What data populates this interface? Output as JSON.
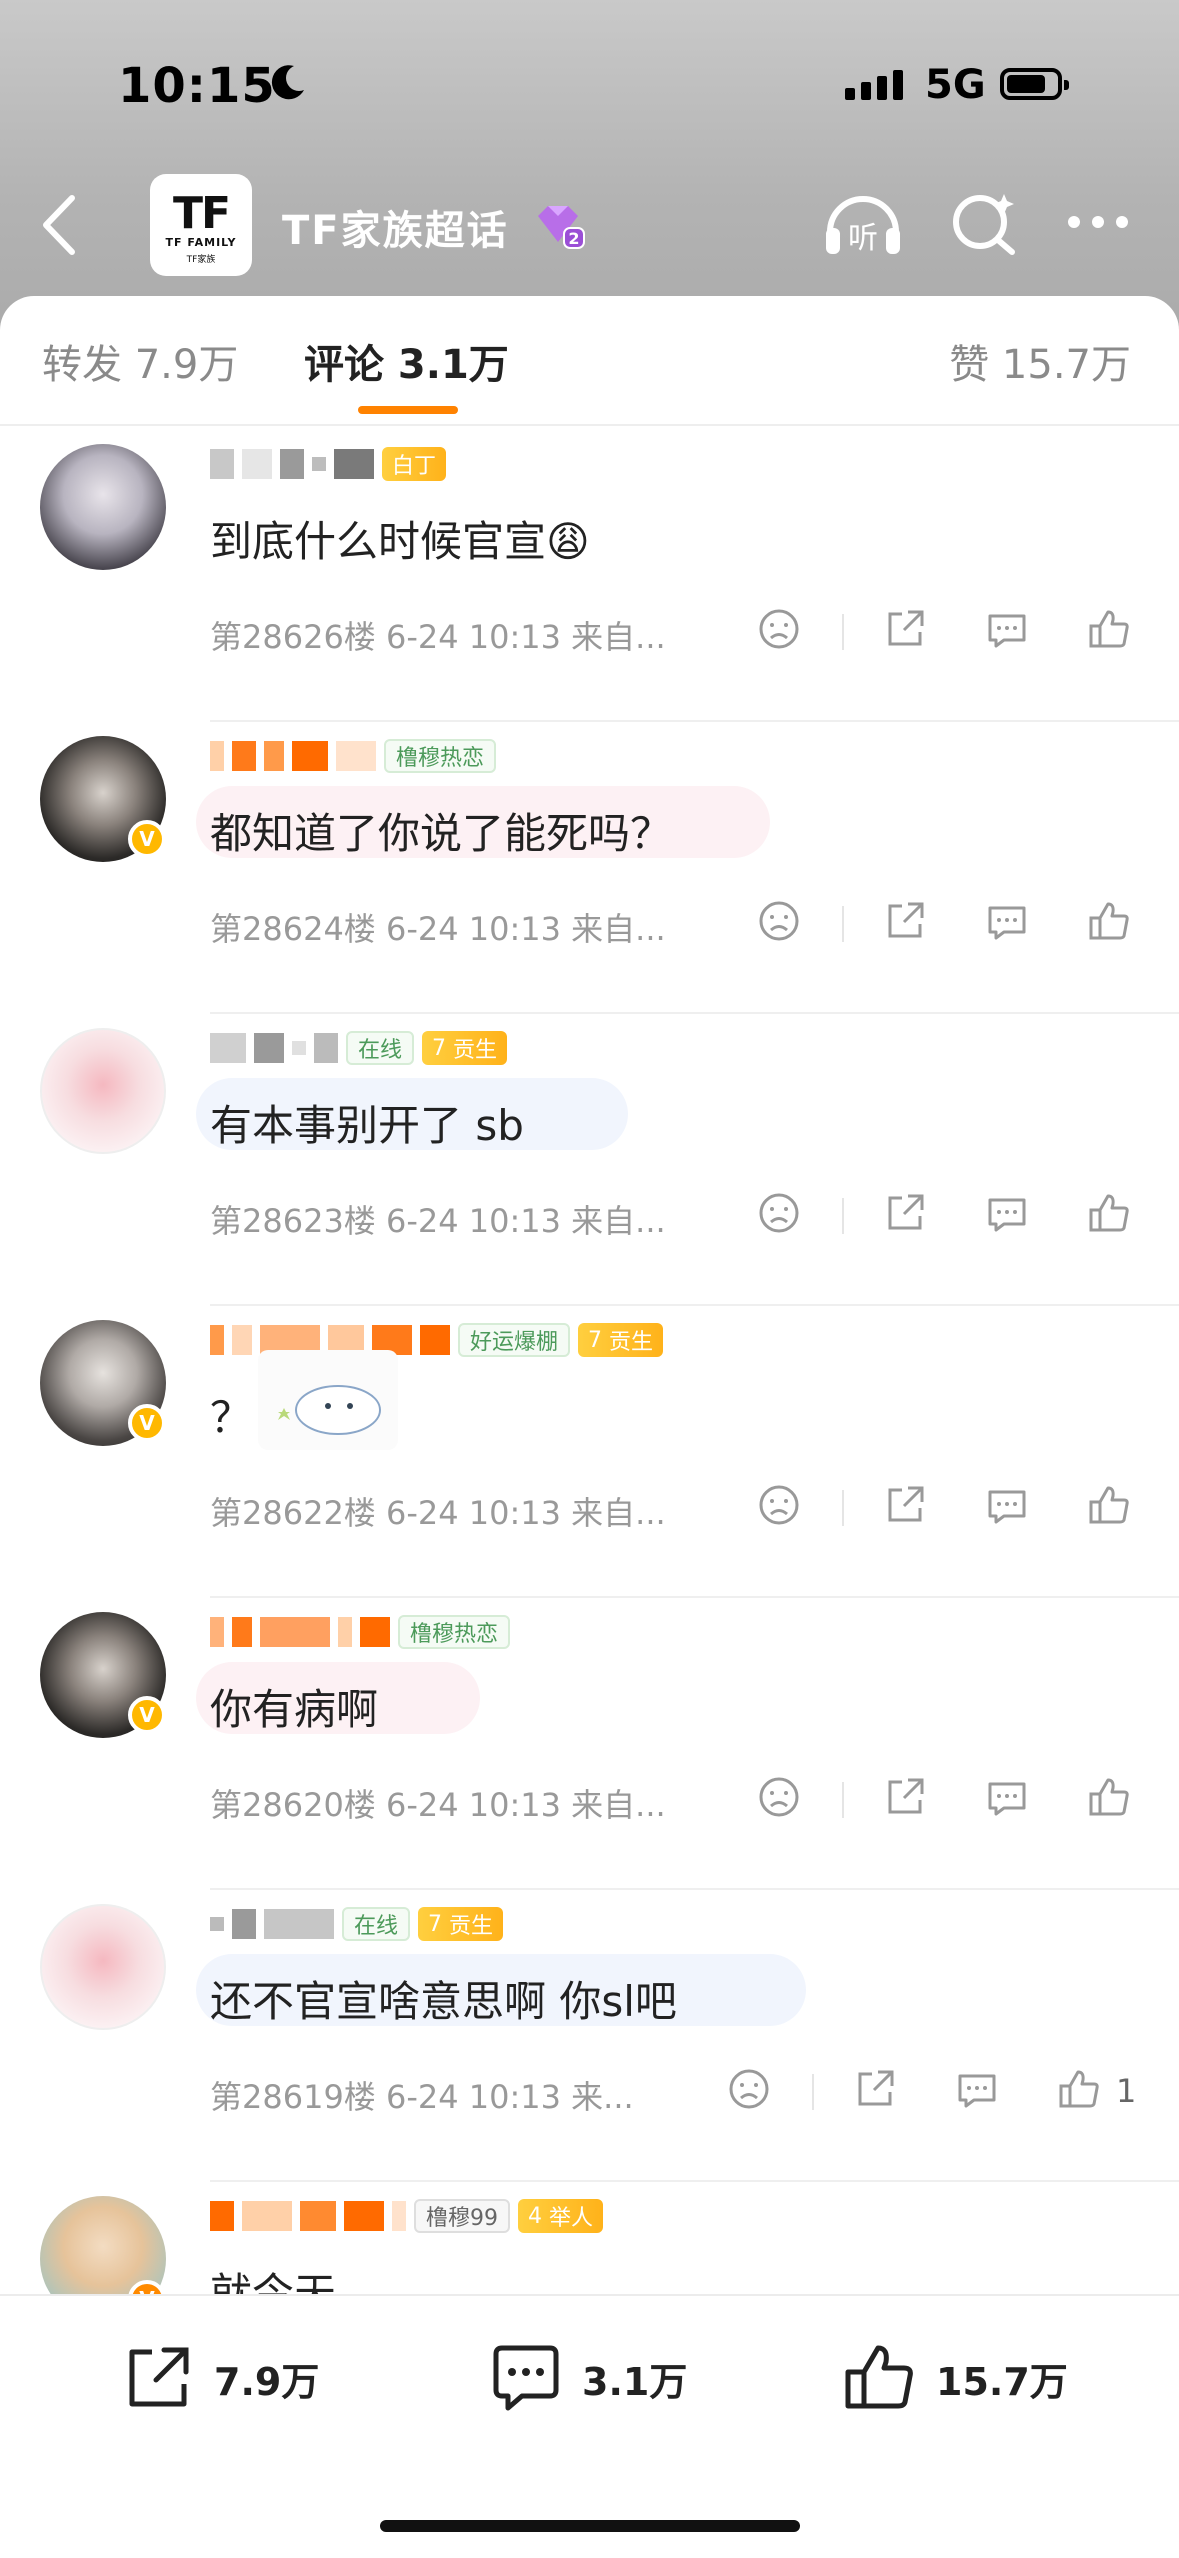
{
  "status": {
    "time": "10:15",
    "network": "5G"
  },
  "header": {
    "title": "TF家族超话",
    "logo_text": "TF",
    "logo_sub": "TF FAMILY",
    "logo_sub2": "TF家族",
    "badge": "2"
  },
  "tabs": {
    "forward": "转发 7.9万",
    "comment": "评论 3.1万",
    "like": "赞 15.7万"
  },
  "comments": [
    {
      "text": "到底什么时候官宣😩",
      "tags": [
        "白丁"
      ],
      "meta": "第28626楼 6-24 10:13 来自...",
      "likes": ""
    },
    {
      "text": "都知道了你说了能死吗？",
      "tags": [
        "橹穆热恋"
      ],
      "meta": "第28624楼 6-24 10:13 来自...",
      "likes": ""
    },
    {
      "text": "有本事别开了 sb",
      "tags": [
        "在线",
        "7",
        "贡生"
      ],
      "meta": "第28623楼 6-24 10:13 来自...",
      "likes": ""
    },
    {
      "text": "？",
      "tags": [
        "好运爆棚",
        "7",
        "贡生"
      ],
      "meta": "第28622楼 6-24 10:13 来自...",
      "likes": ""
    },
    {
      "text": "你有病啊",
      "tags": [
        "橹穆热恋"
      ],
      "meta": "第28620楼 6-24 10:13 来自...",
      "likes": ""
    },
    {
      "text": "还不官宣啥意思啊 你sl吧",
      "tags": [
        "在线",
        "7",
        "贡生"
      ],
      "meta": "第28619楼 6-24 10:13 来...",
      "likes": "1"
    },
    {
      "text": "就今天",
      "tags": [
        "橹穆99",
        "4",
        "举人"
      ],
      "meta": "",
      "likes": ""
    }
  ],
  "bottom": {
    "forward": "7.9万",
    "comment": "3.1万",
    "like": "15.7万"
  }
}
